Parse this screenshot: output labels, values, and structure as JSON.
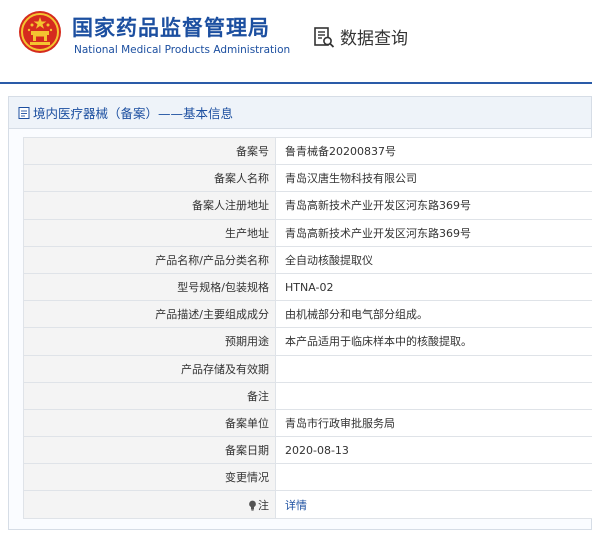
{
  "header": {
    "title_cn": "国家药品监督管理局",
    "title_en": "National Medical Products Administration",
    "query_label": "数据查询",
    "colors": {
      "brand_blue": "#1c4fa0",
      "emblem_red": "#d52b1e",
      "emblem_gold": "#f4c430"
    },
    "icons": {
      "emblem": "national-emblem-icon",
      "query": "document-search-icon"
    }
  },
  "panel": {
    "title": "境内医疗器械（备案）——基本信息",
    "icon": "document-icon"
  },
  "rows": [
    {
      "key": "备案号",
      "value": "鲁青械备20200837号"
    },
    {
      "key": "备案人名称",
      "value": "青岛汉唐生物科技有限公司"
    },
    {
      "key": "备案人注册地址",
      "value": "青岛高新技术产业开发区河东路369号"
    },
    {
      "key": "生产地址",
      "value": "青岛高新技术产业开发区河东路369号"
    },
    {
      "key": "产品名称/产品分类名称",
      "value": "全自动核酸提取仪"
    },
    {
      "key": "型号规格/包装规格",
      "value": "HTNA-02"
    },
    {
      "key": "产品描述/主要组成成分",
      "value": "由机械部分和电气部分组成。"
    },
    {
      "key": "预期用途",
      "value": "本产品适用于临床样本中的核酸提取。"
    },
    {
      "key": "产品存储及有效期",
      "value": ""
    },
    {
      "key": "备注",
      "value": ""
    },
    {
      "key": "备案单位",
      "value": "青岛市行政审批服务局"
    },
    {
      "key": "备案日期",
      "value": "2020-08-13"
    },
    {
      "key": "变更情况",
      "value": ""
    },
    {
      "key": "注",
      "value": "详情",
      "icon": "lightbulb-icon",
      "link": true
    }
  ]
}
